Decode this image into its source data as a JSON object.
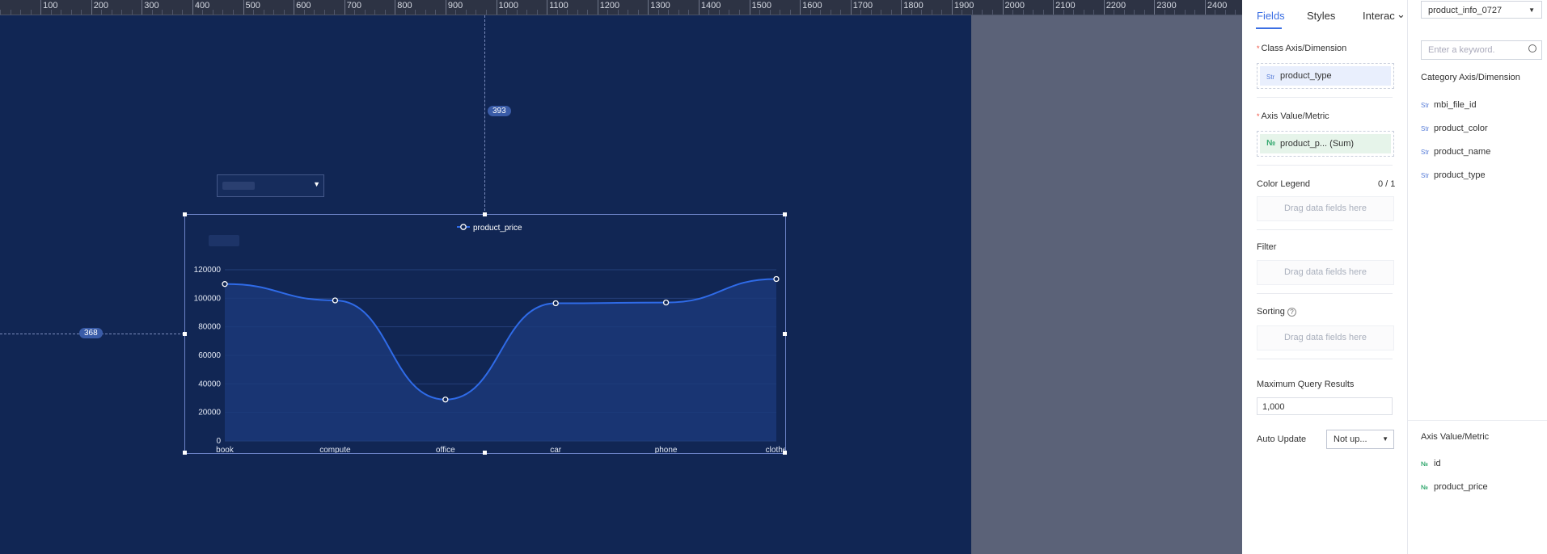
{
  "ruler": {
    "labels": [
      "100",
      "200",
      "300",
      "400",
      "500",
      "600",
      "700",
      "800",
      "900",
      "1000",
      "1100",
      "1200",
      "1300",
      "1400",
      "1500",
      "1600",
      "1700",
      "1800",
      "1900",
      "2000",
      "2100",
      "2200",
      "2300",
      "2400"
    ]
  },
  "canvas": {
    "guide_top_value": "393",
    "guide_left_value": "368",
    "colors": {
      "screen_bg": "#112654",
      "line": "#2f6be8",
      "area": "#1b3a7a"
    }
  },
  "chart_data": {
    "type": "area",
    "legend": [
      "product_price"
    ],
    "categories": [
      "book",
      "compute",
      "office",
      "car",
      "phone",
      "clothe"
    ],
    "series": [
      {
        "name": "product_price",
        "values": [
          110000,
          98500,
          29000,
          96500,
          97000,
          113500
        ]
      }
    ],
    "yticks": [
      "120000",
      "100000",
      "80000",
      "60000",
      "40000",
      "20000",
      "0"
    ],
    "ylim": [
      0,
      120000
    ],
    "smooth": true,
    "grid": true,
    "legend_position": "top-center"
  },
  "panel": {
    "tabs": [
      "Fields",
      "Styles",
      "Interac"
    ],
    "class_axis": {
      "title": "Class Axis/Dimension",
      "field": "product_type",
      "icon": "Str"
    },
    "axis_value": {
      "title": "Axis Value/Metric",
      "field": "product_p... (Sum)",
      "icon": "№"
    },
    "color_legend": {
      "title": "Color Legend",
      "count": "0 / 1",
      "placeholder": "Drag data fields here"
    },
    "filter": {
      "title": "Filter",
      "placeholder": "Drag data fields here"
    },
    "sorting": {
      "title": "Sorting",
      "placeholder": "Drag data fields here"
    },
    "max_query": {
      "title": "Maximum Query Results",
      "value": "1,000"
    },
    "auto_update": {
      "title": "Auto Update",
      "value": "Not up..."
    }
  },
  "fields_panel": {
    "dataset": "product_info_0727",
    "search_placeholder": "Enter a keyword.",
    "dimension_heading": "Category Axis/Dimension",
    "dimensions": [
      "mbi_file_id",
      "product_color",
      "product_name",
      "product_type"
    ],
    "metric_heading": "Axis Value/Metric",
    "metrics": [
      "id",
      "product_price"
    ],
    "str_icon": "Str",
    "num_icon": "№"
  }
}
